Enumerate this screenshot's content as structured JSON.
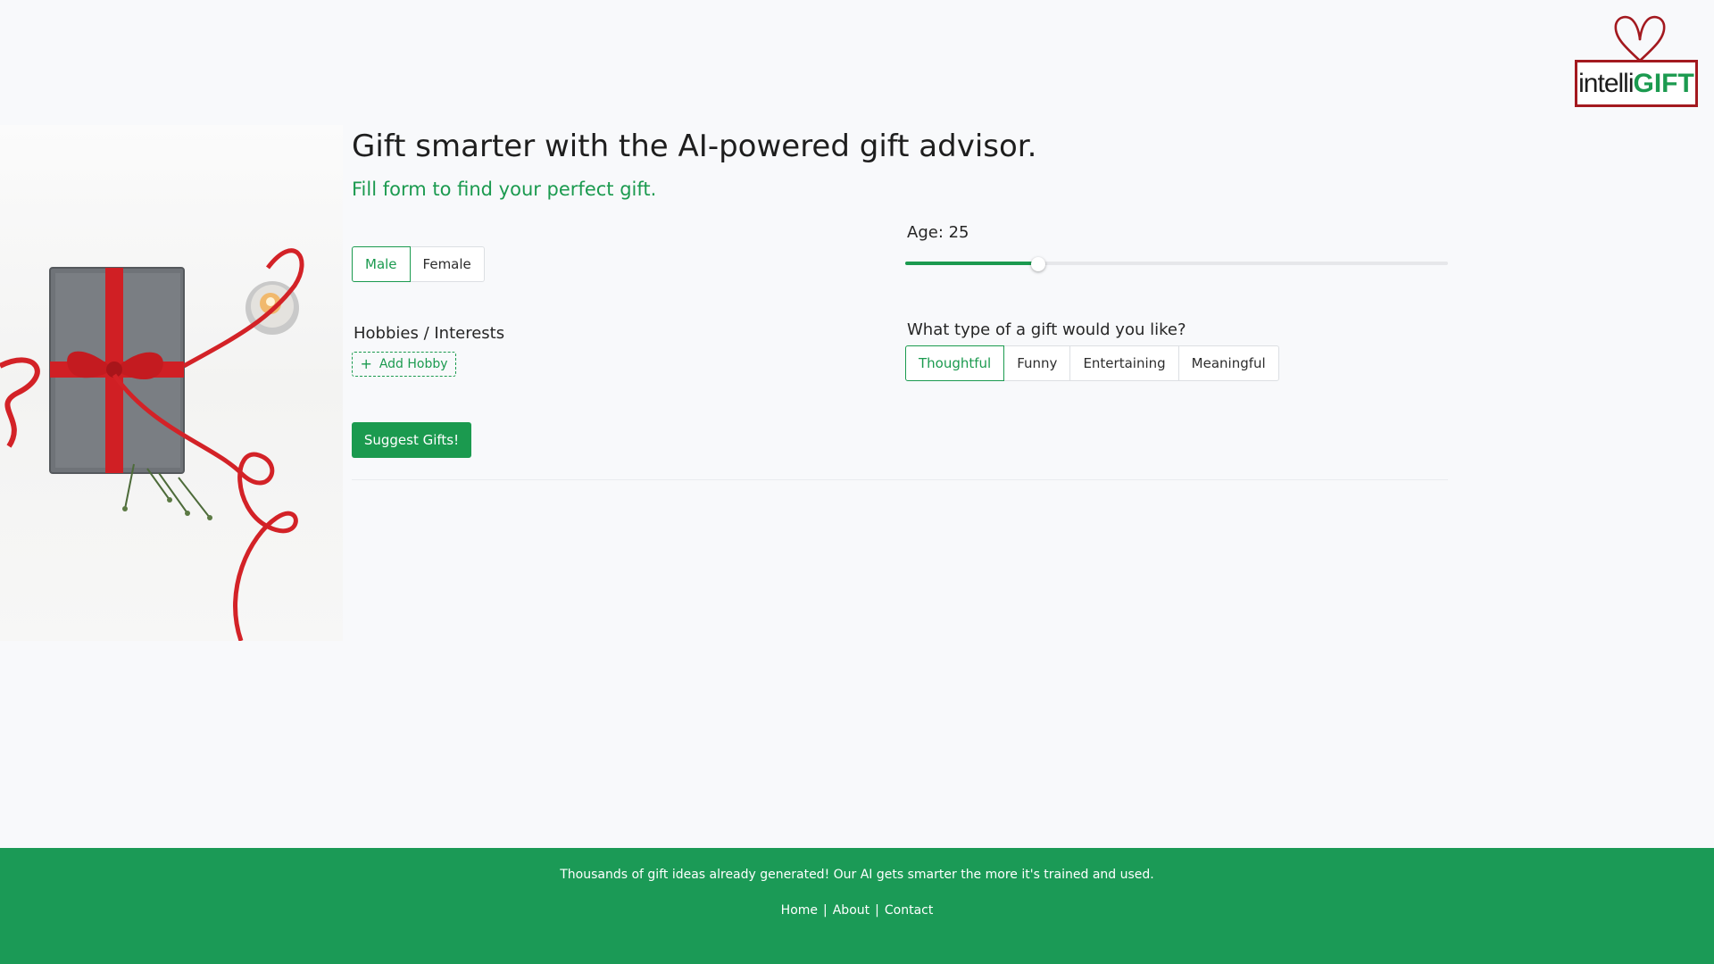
{
  "brand": {
    "logo_text_light": "intelli",
    "logo_text_bold": "GIFT",
    "colors": {
      "accent": "#1b9a4f",
      "logo_red": "#a3191f",
      "footer": "#1b9a56"
    }
  },
  "header": {
    "title": "Gift smarter with the AI-powered gift advisor.",
    "subtitle": "Fill form to find your perfect gift."
  },
  "form": {
    "gender": {
      "options": [
        "Male",
        "Female"
      ],
      "selected": "Male"
    },
    "age": {
      "label": "Age: 25",
      "value": 25,
      "fill_fraction": 0.245
    },
    "hobbies": {
      "label": "Hobbies / Interests",
      "add_button": "Add Hobby",
      "add_icon": "plus-icon"
    },
    "gift_type": {
      "label": "What type of a gift would you like?",
      "options": [
        "Thoughtful",
        "Funny",
        "Entertaining",
        "Meaningful"
      ],
      "selected": "Thoughtful"
    },
    "submit_label": "Suggest Gifts!"
  },
  "footer": {
    "tagline": "Thousands of gift ideas already generated! Our AI gets smarter the more it's trained and used.",
    "links": [
      "Home",
      "About",
      "Contact"
    ],
    "separator": "|"
  }
}
